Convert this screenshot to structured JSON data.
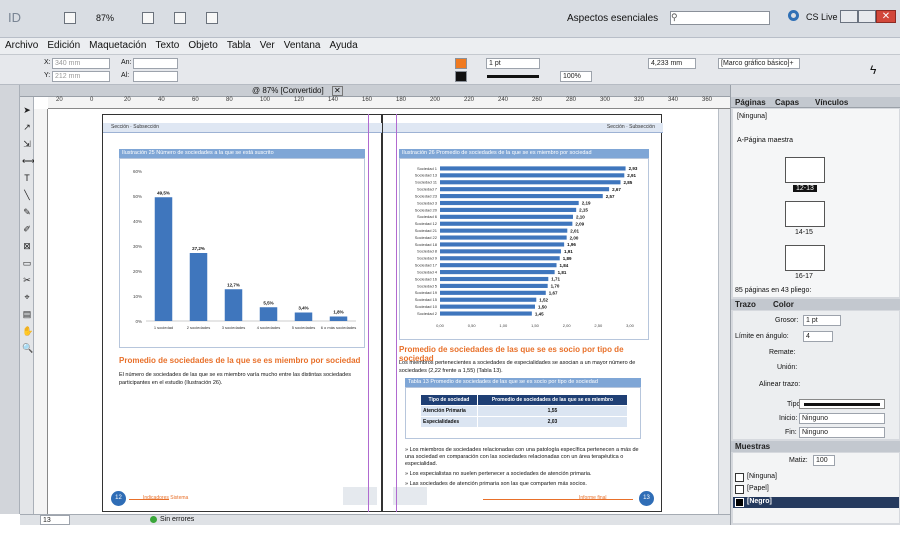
{
  "app": {
    "logo": "ID",
    "zoom": "87%",
    "workspace": "Aspectos esenciales",
    "cs_live": "CS Live"
  },
  "menu": [
    "Archivo",
    "Edición",
    "Maquetación",
    "Texto",
    "Objeto",
    "Tabla",
    "Ver",
    "Ventana",
    "Ayuda"
  ],
  "control": {
    "x": "340 mm",
    "y": "212 mm",
    "w_label": "An:",
    "h_label": "Al:",
    "x_label": "X:",
    "y_label": "Y:",
    "stroke": "1 pt",
    "size": "4,233 mm",
    "opacity": "100%",
    "frame_style": "[Marco gráfico básico]+"
  },
  "document_tab": "@ 87% [Convertido]",
  "rulers": {
    "h": [
      "20",
      "0",
      "20",
      "40",
      "60",
      "80",
      "100",
      "120",
      "140",
      "160",
      "180",
      "200",
      "220",
      "240",
      "260",
      "280",
      "300",
      "320",
      "340",
      "360"
    ]
  },
  "page_left": {
    "header": "Sección · Subsección",
    "fig_title": "Ilustración 25 Número de sociedades a la que se está suscrito",
    "y_ticks": [
      "60%",
      "50%",
      "40%",
      "30%",
      "20%",
      "10%",
      "0%"
    ],
    "section_heading": "Promedio de sociedades de la que se es miembro por sociedad",
    "body": "El número de sociedades de las que se es miembro varía mucho entre las distintas sociedades participantes en el estudio (Ilustración 26).",
    "footer_left": "Indicadores Sistema",
    "page_num": "12"
  },
  "page_right": {
    "header": "Sección · Subsección",
    "fig_title": "Ilustración 26 Promedio de sociedades de la que se es miembro por sociedad",
    "x_ticks": [
      "0,00",
      "0,50",
      "1,00",
      "1,50",
      "2,00",
      "2,50",
      "3,00"
    ],
    "section_heading": "Promedio de sociedades de las que se es socio por tipo de sociedad",
    "body": "Los miembros pertenecientes a sociedades de especialidades se asocian a un mayor número de sociedades (2,22 frente a 1,55) (Tabla 13).",
    "table_title": "Tabla 13 Promedio de sociedades de las que se es socio por tipo de sociedad",
    "table_headers": [
      "Tipo de sociedad",
      "Promedio de sociedades de las que se es miembro"
    ],
    "table_rows": [
      [
        "Atención Primaria",
        "1,55"
      ],
      [
        "Especialidades",
        "2,03"
      ]
    ],
    "bullets": [
      "Los miembros de sociedades relacionadas con una patología específica pertenecen a más de una sociedad en comparación con las sociedades relacionadas con un área terapéutica o especialidad.",
      "Los especialistas no suelen pertenecer a sociedades de atención primaria.",
      "Las sociedades de atención primaria son las que comparten más socios."
    ],
    "footer_right": "Informe final",
    "page_num": "13"
  },
  "chart_data": [
    {
      "type": "bar",
      "title": "Ilustración 25 Número de sociedades a la que se está suscrito",
      "categories": [
        "1 sociedad",
        "2 sociedades",
        "3 sociedades",
        "4 sociedades",
        "5 sociedades",
        "6 o más sociedades"
      ],
      "values": [
        49.5,
        27.2,
        12.7,
        5.5,
        3.4,
        1.8
      ],
      "labels": [
        "49,5%",
        "27,2%",
        "12,7%",
        "5,5%",
        "3,4%",
        "1,8%"
      ],
      "ylim": [
        0,
        60
      ]
    },
    {
      "type": "bar",
      "orientation": "horizontal",
      "title": "Ilustración 26 Promedio de sociedades de la que se es miembro por sociedad",
      "categories": [
        "Sociedad 1",
        "Sociedad 13",
        "Sociedad 11",
        "Sociedad 7",
        "Sociedad 23",
        "Sociedad 3",
        "Sociedad 20",
        "Sociedad 6",
        "Sociedad 12",
        "Sociedad 21",
        "Sociedad 22",
        "Sociedad 18",
        "Sociedad 8",
        "Sociedad 9",
        "Sociedad 17",
        "Sociedad 4",
        "Sociedad 16",
        "Sociedad 5",
        "Sociedad 19",
        "Sociedad 15",
        "Sociedad 10",
        "Sociedad 2"
      ],
      "values": [
        2.93,
        2.91,
        2.85,
        2.67,
        2.57,
        2.19,
        2.15,
        2.1,
        2.09,
        2.01,
        2.0,
        1.96,
        1.91,
        1.89,
        1.84,
        1.81,
        1.71,
        1.7,
        1.67,
        1.52,
        1.5,
        1.45
      ],
      "labels": [
        "2,93",
        "2,91",
        "2,85",
        "2,67",
        "2,57",
        "2,19",
        "2,15",
        "2,10",
        "2,09",
        "2,01",
        "2,00",
        "1,96",
        "1,91",
        "1,89",
        "1,84",
        "1,81",
        "1,71",
        "1,70",
        "1,67",
        "1,52",
        "1,50",
        "1,45"
      ],
      "xlim": [
        0,
        3
      ]
    }
  ],
  "panels": {
    "pages": {
      "tabs": [
        "Páginas",
        "Capas",
        "Vínculos"
      ],
      "none": "[Ninguna]",
      "master": "A-Página maestra",
      "spreads": [
        "12-13",
        "14-15",
        "16-17"
      ],
      "status": "85 páginas en 43 pliego:"
    },
    "stroke": {
      "tabs": [
        "Trazo",
        "Color"
      ],
      "weight_label": "Grosor:",
      "weight": "1 pt",
      "miter_label": "Límite en ángulo:",
      "miter": "4",
      "cap_label": "Remate:",
      "join_label": "Unión:",
      "align_label": "Alinear trazo:",
      "type_label": "Tipo:",
      "start_label": "Inicio:",
      "start": "Ninguno",
      "end_label": "Fin:",
      "end": "Ninguno"
    },
    "swatches": {
      "tab": "Muestras",
      "tint_label": "Matiz:",
      "tint": "100",
      "items": [
        "[Ninguna]",
        "[Papel]",
        "[Negro]"
      ]
    }
  },
  "status": {
    "page": "13",
    "errors": "Sin errores"
  }
}
